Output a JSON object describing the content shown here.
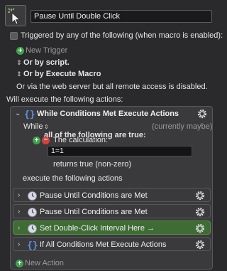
{
  "header": {
    "macro_name": "Pause Until Double Click",
    "macro_icon": "cursor-click-icon"
  },
  "triggers": {
    "enabled_text": "Triggered by any of the following (when macro is enabled):",
    "new_trigger_label": "New Trigger",
    "or_by_script": "Or by script.",
    "or_by_execute_macro": "Or by Execute Macro",
    "or_via_web_server": "Or via the web server but all remote access is disabled."
  },
  "actions_intro": "Will execute the following actions:",
  "while_block": {
    "title": "While Conditions Met Execute Actions",
    "while_label": "While",
    "condition_mode": "all of the following are true:",
    "status_text": "(currently maybe)",
    "calculation_label": "The calculation:",
    "calculation_value": "1=1",
    "result_text": "returns true (non-zero)",
    "execute_label": "execute the following actions",
    "nested_actions": [
      {
        "title": "Pause Until Conditions are Met",
        "icon": "pause-clock-icon",
        "collapsed": true,
        "highlight": false
      },
      {
        "title": "Pause Until Conditions are Met",
        "icon": "pause-clock-icon",
        "collapsed": true,
        "highlight": false
      },
      {
        "title": "Set Double-Click Interval Here →",
        "icon": "pause-clock-icon",
        "collapsed": true,
        "highlight": true
      },
      {
        "title": "If All Conditions Met Execute Actions",
        "icon": "braces-icon",
        "collapsed": true,
        "highlight": false
      }
    ]
  },
  "new_action_label": "New Action",
  "colors": {
    "background": "#2a2a2c",
    "action_block": "#3a3a3c",
    "highlight_green": "#3f6b35",
    "accent_blue": "#4a7fd8",
    "add_green": "#3fa34d",
    "remove_red": "#d9413a"
  }
}
